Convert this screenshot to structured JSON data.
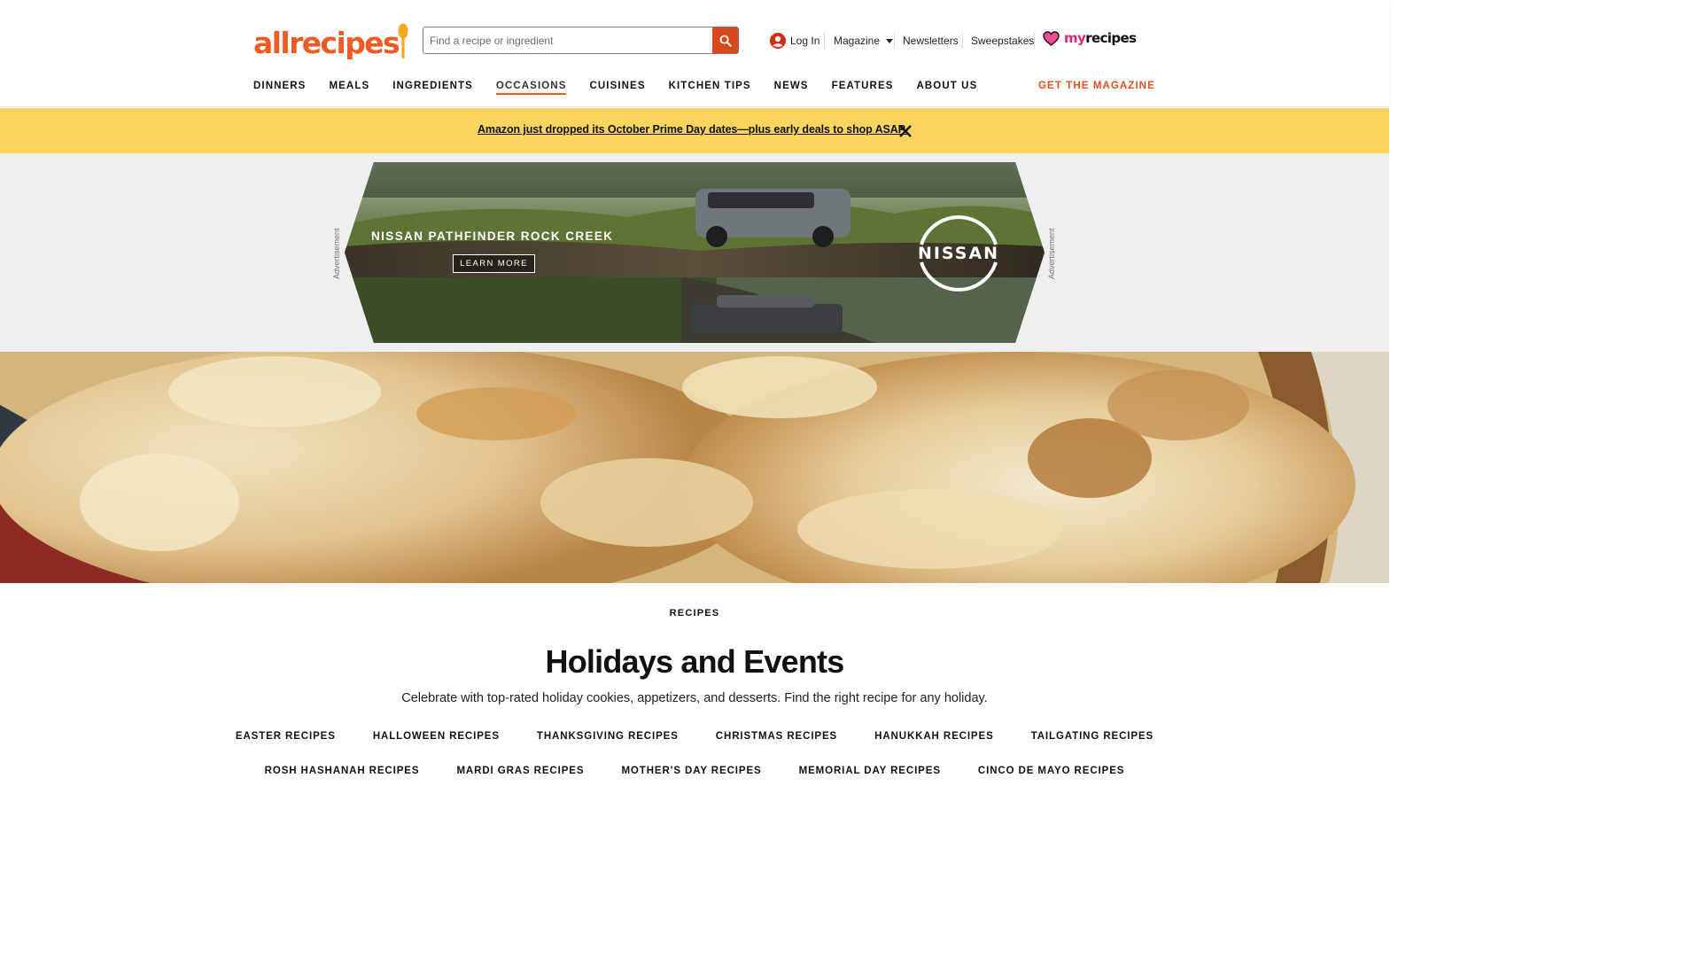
{
  "header": {
    "logo_text": "allrecipes",
    "search": {
      "placeholder": "Find a recipe or ingredient",
      "value": ""
    },
    "utility": {
      "login": "Log In",
      "magazine": "Magazine",
      "newsletters": "Newsletters",
      "sweepstakes": "Sweepstakes",
      "myrecipes_my": "my",
      "myrecipes_recipes": "recipes"
    },
    "nav": [
      {
        "label": "DINNERS"
      },
      {
        "label": "MEALS"
      },
      {
        "label": "INGREDIENTS"
      },
      {
        "label": "OCCASIONS",
        "active": true
      },
      {
        "label": "CUISINES"
      },
      {
        "label": "KITCHEN TIPS"
      },
      {
        "label": "NEWS"
      },
      {
        "label": "FEATURES"
      },
      {
        "label": "ABOUT US"
      }
    ],
    "get_magazine": "GET THE MAGAZINE"
  },
  "promo": {
    "text": "Amazon just dropped its October Prime Day dates—plus early deals to shop ASAP."
  },
  "ad": {
    "label": "Advertisement",
    "title": "NISSAN PATHFINDER ROCK CREEK",
    "cta": "LEARN MORE",
    "brand": "NISSAN"
  },
  "content": {
    "eyebrow": "RECIPES",
    "title": "Holidays and Events",
    "description": "Celebrate with top-rated holiday cookies, appetizers, and desserts. Find the right recipe for any holiday.",
    "links_row1": [
      "EASTER RECIPES",
      "HALLOWEEN RECIPES",
      "THANKSGIVING RECIPES",
      "CHRISTMAS RECIPES",
      "HANUKKAH RECIPES",
      "TAILGATING RECIPES"
    ],
    "links_row2": [
      "ROSH HASHANAH RECIPES",
      "MARDI GRAS RECIPES",
      "MOTHER'S DAY RECIPES",
      "MEMORIAL DAY RECIPES",
      "CINCO DE MAYO RECIPES"
    ]
  },
  "colors": {
    "brand_orange": "#ef5b25",
    "search_button": "#d64a19",
    "promo_yellow": "#fbd55d",
    "myrecipes_pink": "#e1267b"
  },
  "icons": [
    "spoon-icon",
    "search-icon",
    "user-icon",
    "caret-down-icon",
    "heart-icon",
    "close-icon"
  ]
}
